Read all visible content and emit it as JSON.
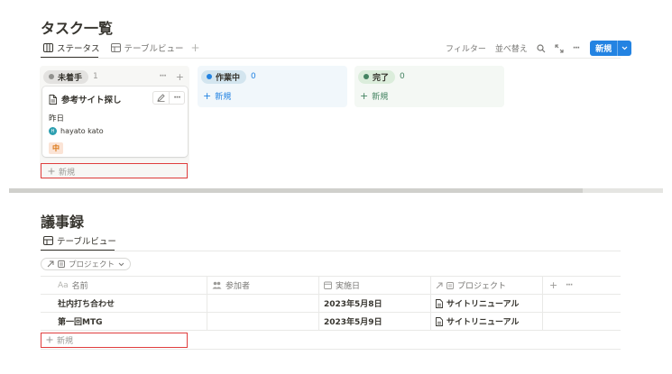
{
  "board": {
    "title": "タスク一覧",
    "tabs": [
      {
        "label": "ステータス",
        "active": true
      },
      {
        "label": "テーブルビュー",
        "active": false
      }
    ],
    "add_view_symbol": "+",
    "toolbar": {
      "filter_label": "フィルター",
      "sort_label": "並べ替え",
      "more_symbol": "···",
      "new_label": "新規"
    },
    "columns": [
      {
        "name": "未着手",
        "count": "1",
        "pill_bg": "#e3e2e0",
        "dot": "#91918e",
        "bg": "#f7f7f5",
        "count_color": "#9b9a97"
      },
      {
        "name": "作業中",
        "count": "0",
        "pill_bg": "#d3e5ef",
        "dot": "#2383e2",
        "bg": "#f1f7fb",
        "count_color": "#2383e2"
      },
      {
        "name": "完了",
        "count": "0",
        "pill_bg": "#dbeddb",
        "dot": "#448361",
        "bg": "#f4f8f4",
        "count_color": "#448361"
      }
    ],
    "column_controls": {
      "more": "···",
      "add": "+"
    },
    "card": {
      "title": "参考サイト探し",
      "date": "昨日",
      "person_initials": "H",
      "person": "hayato kato",
      "priority": "中"
    },
    "new_row_label": "新規"
  },
  "minutes": {
    "title": "議事録",
    "tab_label": "テーブルビュー",
    "filter_chip": "プロジェクト",
    "headers": {
      "name_prefix": "Aa",
      "name": "名前",
      "participants": "参加者",
      "date": "実施日",
      "project": "プロジェクト",
      "add": "+",
      "more": "···"
    },
    "rows": [
      {
        "name": "社内打ち合わせ",
        "participants": "",
        "date": "2023年5月8日",
        "project": "サイトリニューアル"
      },
      {
        "name": "第一回MTG",
        "participants": "",
        "date": "2023年5月9日",
        "project": "サイトリニューアル"
      }
    ],
    "new_row_label": "新規"
  },
  "colors": {
    "accent": "#2383e2",
    "highlight_box": "#e03e3e"
  }
}
